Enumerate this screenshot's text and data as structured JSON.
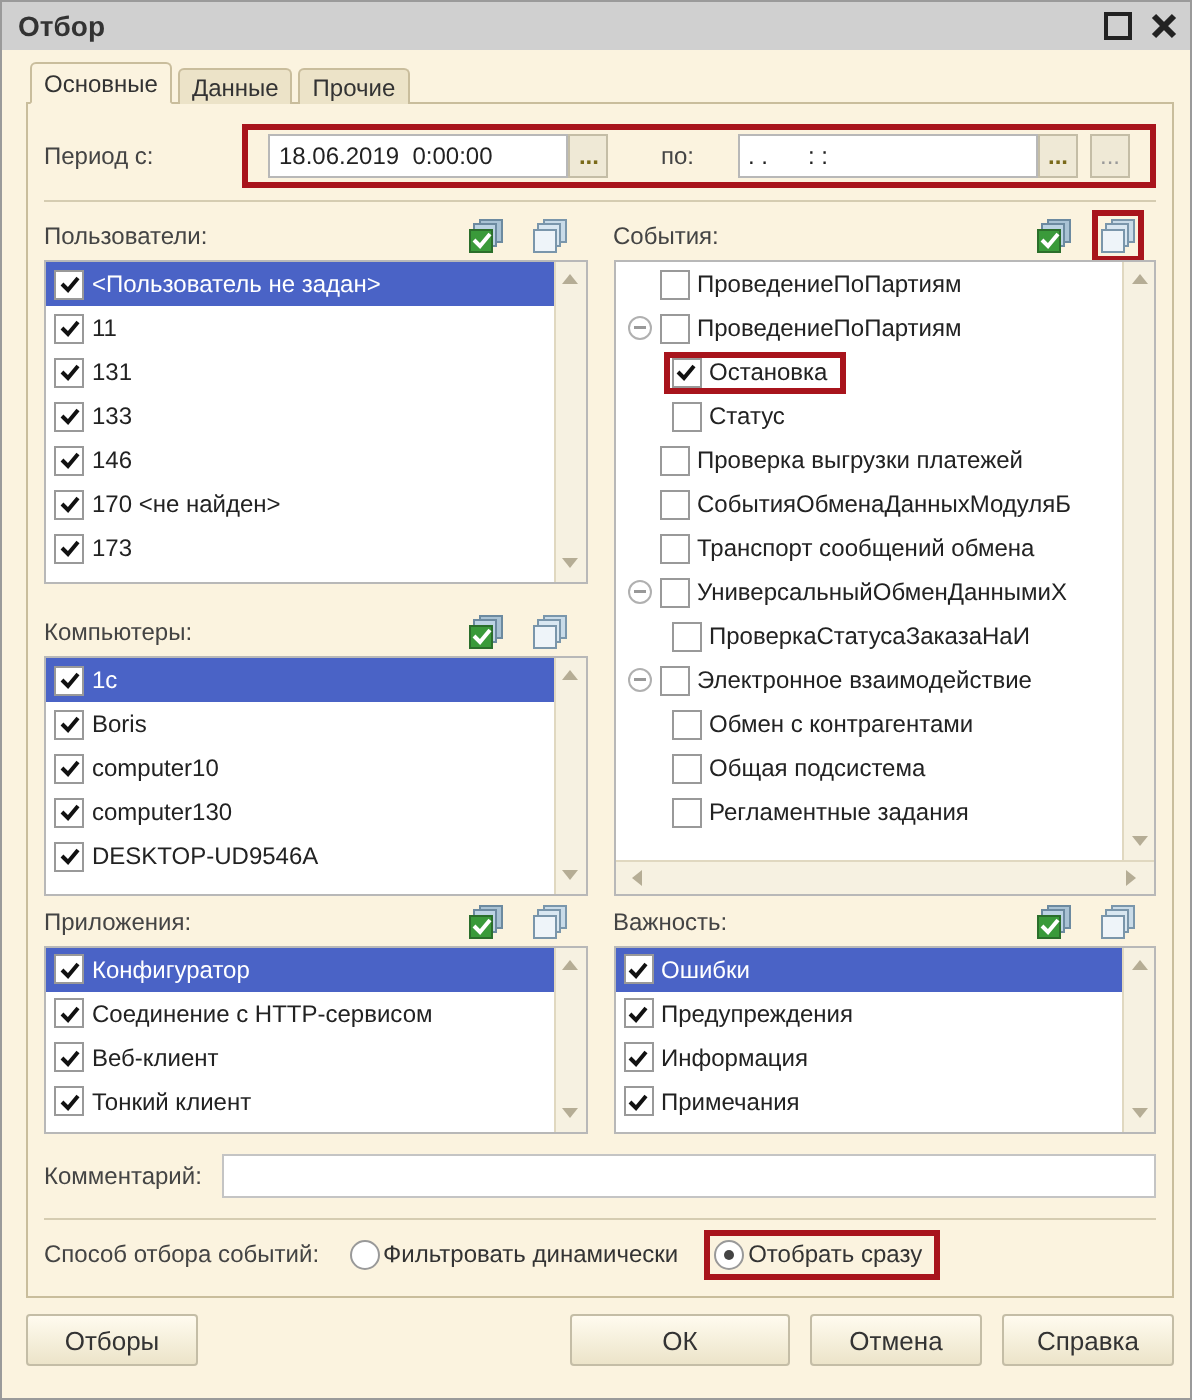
{
  "window": {
    "title": "Отбор"
  },
  "tabs": [
    {
      "label": "Основные",
      "selected": true
    },
    {
      "label": "Данные",
      "selected": false
    },
    {
      "label": "Прочие",
      "selected": false
    }
  ],
  "period": {
    "label": "Период с:",
    "from": "18.06.2019  0:00:00",
    "from_button": "...",
    "to_label": "по:",
    "to": ". .      : :",
    "to_button": "...",
    "clear_button": "...",
    "highlighted": true
  },
  "users": {
    "label": "Пользователи:",
    "items": [
      {
        "label": "<Пользователь не задан>",
        "checked": true,
        "selected": true
      },
      {
        "label": "11",
        "checked": true,
        "selected": false
      },
      {
        "label": "131",
        "checked": true,
        "selected": false
      },
      {
        "label": "133",
        "checked": true,
        "selected": false
      },
      {
        "label": "146",
        "checked": true,
        "selected": false
      },
      {
        "label": "170 <не найден>",
        "checked": true,
        "selected": false
      },
      {
        "label": "173",
        "checked": true,
        "selected": false
      }
    ]
  },
  "computers": {
    "label": "Компьютеры:",
    "items": [
      {
        "label": "1c",
        "checked": true,
        "selected": true
      },
      {
        "label": "Boris",
        "checked": true,
        "selected": false
      },
      {
        "label": "computer10",
        "checked": true,
        "selected": false
      },
      {
        "label": "computer130",
        "checked": true,
        "selected": false
      },
      {
        "label": "DESKTOP-UD9546A",
        "checked": true,
        "selected": false
      }
    ]
  },
  "applications": {
    "label": "Приложения:",
    "items": [
      {
        "label": "Конфигуратор",
        "checked": true,
        "selected": true
      },
      {
        "label": "Соединение с HTTP-сервисом",
        "checked": true,
        "selected": false
      },
      {
        "label": "Веб-клиент",
        "checked": true,
        "selected": false
      },
      {
        "label": "Тонкий клиент",
        "checked": true,
        "selected": false
      }
    ]
  },
  "events": {
    "label": "События:",
    "uncheck_highlighted": true,
    "items": [
      {
        "label": "ПроведениеПоПартиям",
        "checked": false
      },
      {
        "label": "ПроведениеПоПартиям",
        "checked": false,
        "expanded": true,
        "children": [
          {
            "label": "Остановка",
            "checked": true,
            "highlighted": true
          },
          {
            "label": "Статус",
            "checked": false
          }
        ]
      },
      {
        "label": "Проверка выгрузки платежей",
        "checked": false
      },
      {
        "label": "СобытияОбменаДанныхМодуляБ",
        "checked": false
      },
      {
        "label": "Транспорт сообщений обмена",
        "checked": false
      },
      {
        "label": "УниверсальныйОбменДаннымиХ",
        "checked": false,
        "expanded": true,
        "children": [
          {
            "label": "ПроверкаСтатусаЗаказаНаИ",
            "checked": false
          }
        ]
      },
      {
        "label": "Электронное взаимодействие",
        "checked": false,
        "expanded": true,
        "children": [
          {
            "label": "Обмен с контрагентами",
            "checked": false
          },
          {
            "label": "Общая подсистема",
            "checked": false
          },
          {
            "label": "Регламентные задания",
            "checked": false
          }
        ]
      }
    ]
  },
  "importance": {
    "label": "Важность:",
    "items": [
      {
        "label": "Ошибки",
        "checked": true,
        "selected": true
      },
      {
        "label": "Предупреждения",
        "checked": true,
        "selected": false
      },
      {
        "label": "Информация",
        "checked": true,
        "selected": false
      },
      {
        "label": "Примечания",
        "checked": true,
        "selected": false
      }
    ]
  },
  "comment": {
    "label": "Комментарий:"
  },
  "mode": {
    "label": "Способ отбора событий:",
    "options": [
      {
        "label": "Фильтровать динамически",
        "selected": false,
        "highlighted": false
      },
      {
        "label": "Отобрать сразу",
        "selected": true,
        "highlighted": true
      }
    ]
  },
  "buttons": [
    {
      "label": "Отборы",
      "kind": "left"
    },
    {
      "label": "ОК",
      "kind": "right"
    },
    {
      "label": "Отмена",
      "kind": "right"
    },
    {
      "label": "Справка",
      "kind": "right"
    }
  ]
}
